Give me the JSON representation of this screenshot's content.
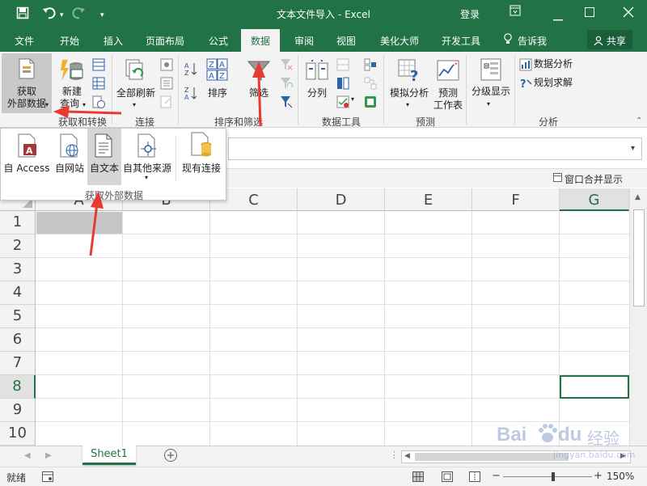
{
  "window": {
    "title": "文本文件导入 - Excel",
    "login": "登录",
    "icons": [
      "save-icon",
      "undo-icon",
      "redo-icon",
      "customize-qat-icon",
      "ribbon-display-icon",
      "minimize-icon",
      "restore-icon",
      "close-icon"
    ]
  },
  "tabs": [
    "文件",
    "开始",
    "插入",
    "页面布局",
    "公式",
    "数据",
    "审阅",
    "视图",
    "美化大师",
    "开发工具"
  ],
  "active_tab": "数据",
  "tell_me": "告诉我",
  "share": "共享",
  "ribbon": {
    "get_external": {
      "line1": "获取",
      "line2": "外部数据"
    },
    "new_query": {
      "line1": "新建",
      "line2": "查询"
    },
    "group_get_transform": "获取和转换",
    "refresh_all": "全部刷新",
    "group_connections": "连接",
    "sort": "排序",
    "filter": "筛选",
    "group_sort_filter": "排序和筛选",
    "text_to_columns": "分列",
    "group_data_tools": "数据工具",
    "what_if": "模拟分析",
    "forecast": {
      "line1": "预测",
      "line2": "工作表"
    },
    "group_forecast": "预测",
    "outline": "分级显示",
    "data_analysis": "数据分析",
    "solver": "规划求解",
    "group_analysis": "分析"
  },
  "dropdown": {
    "items": [
      "自 Access",
      "自网站",
      "自文本",
      "自其他来源",
      "现有连接"
    ],
    "group_label": "获取外部数据"
  },
  "merge_window": "窗口合并显示",
  "grid": {
    "columns": [
      "A",
      "B",
      "C",
      "D",
      "E",
      "F",
      "G"
    ],
    "rows": [
      "1",
      "2",
      "3",
      "4",
      "5",
      "6",
      "7",
      "8",
      "9",
      "10"
    ],
    "active_column": "G",
    "active_row": "8"
  },
  "sheet_tab": "Sheet1",
  "status": {
    "ready": "就绪",
    "zoom": "150%"
  },
  "watermark": {
    "brand": "Bai",
    "brand2": "du",
    "suffix": "经验",
    "url": "jingyan.baidu.com"
  },
  "colors": {
    "excel_green": "#217346",
    "arrow_red": "#e83a32"
  }
}
